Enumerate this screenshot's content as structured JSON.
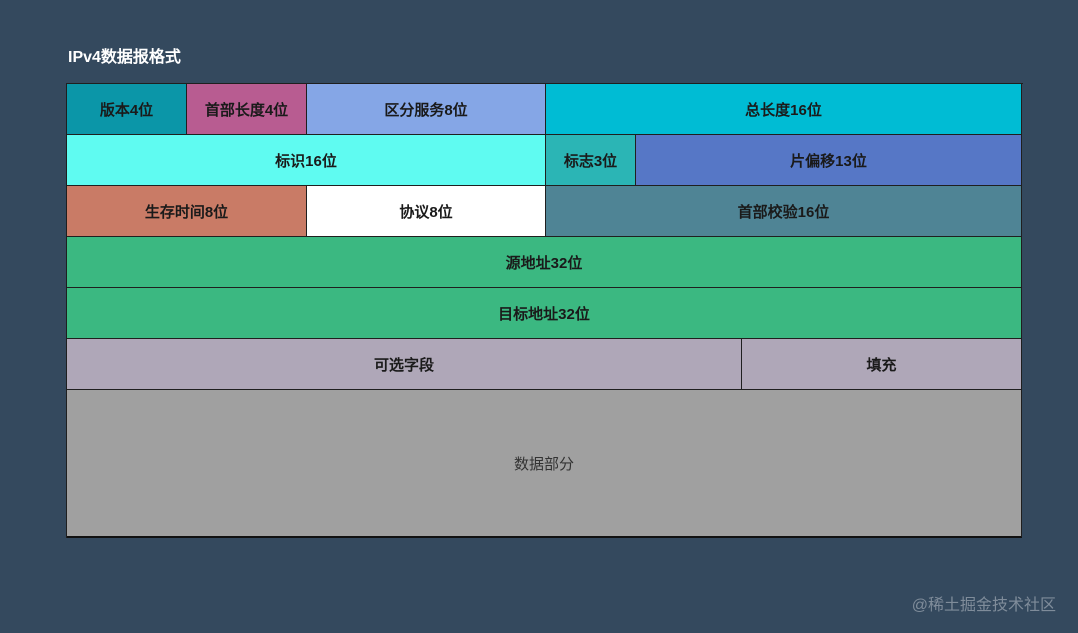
{
  "title": "IPv4数据报格式",
  "rows": [
    [
      {
        "label": "版本4位",
        "color": "#0b96a8"
      },
      {
        "label": "首部长度4位",
        "color": "#b85c91"
      },
      {
        "label": "区分服务8位",
        "color": "#85a6e6"
      },
      {
        "label": "总长度16位",
        "color": "#00bcd4"
      }
    ],
    [
      {
        "label": "标识16位",
        "color": "#5ffbf1"
      },
      {
        "label": "标志3位",
        "color": "#2bb5b5"
      },
      {
        "label": "片偏移13位",
        "color": "#5677c6"
      }
    ],
    [
      {
        "label": "生存时间8位",
        "color": "#c97b66"
      },
      {
        "label": "协议8位",
        "color": "#ffffff"
      },
      {
        "label": "首部校验16位",
        "color": "#4f8495"
      }
    ],
    [
      {
        "label": "源地址32位",
        "color": "#3bb881"
      }
    ],
    [
      {
        "label": "目标地址32位",
        "color": "#3bb881"
      }
    ],
    [
      {
        "label": "可选字段",
        "color": "#afa7b8"
      },
      {
        "label": "填充",
        "color": "#afa7b8"
      }
    ],
    [
      {
        "label": "数据部分",
        "color": "#a0a0a0"
      }
    ]
  ],
  "watermark": "@稀土掘金技术社区"
}
